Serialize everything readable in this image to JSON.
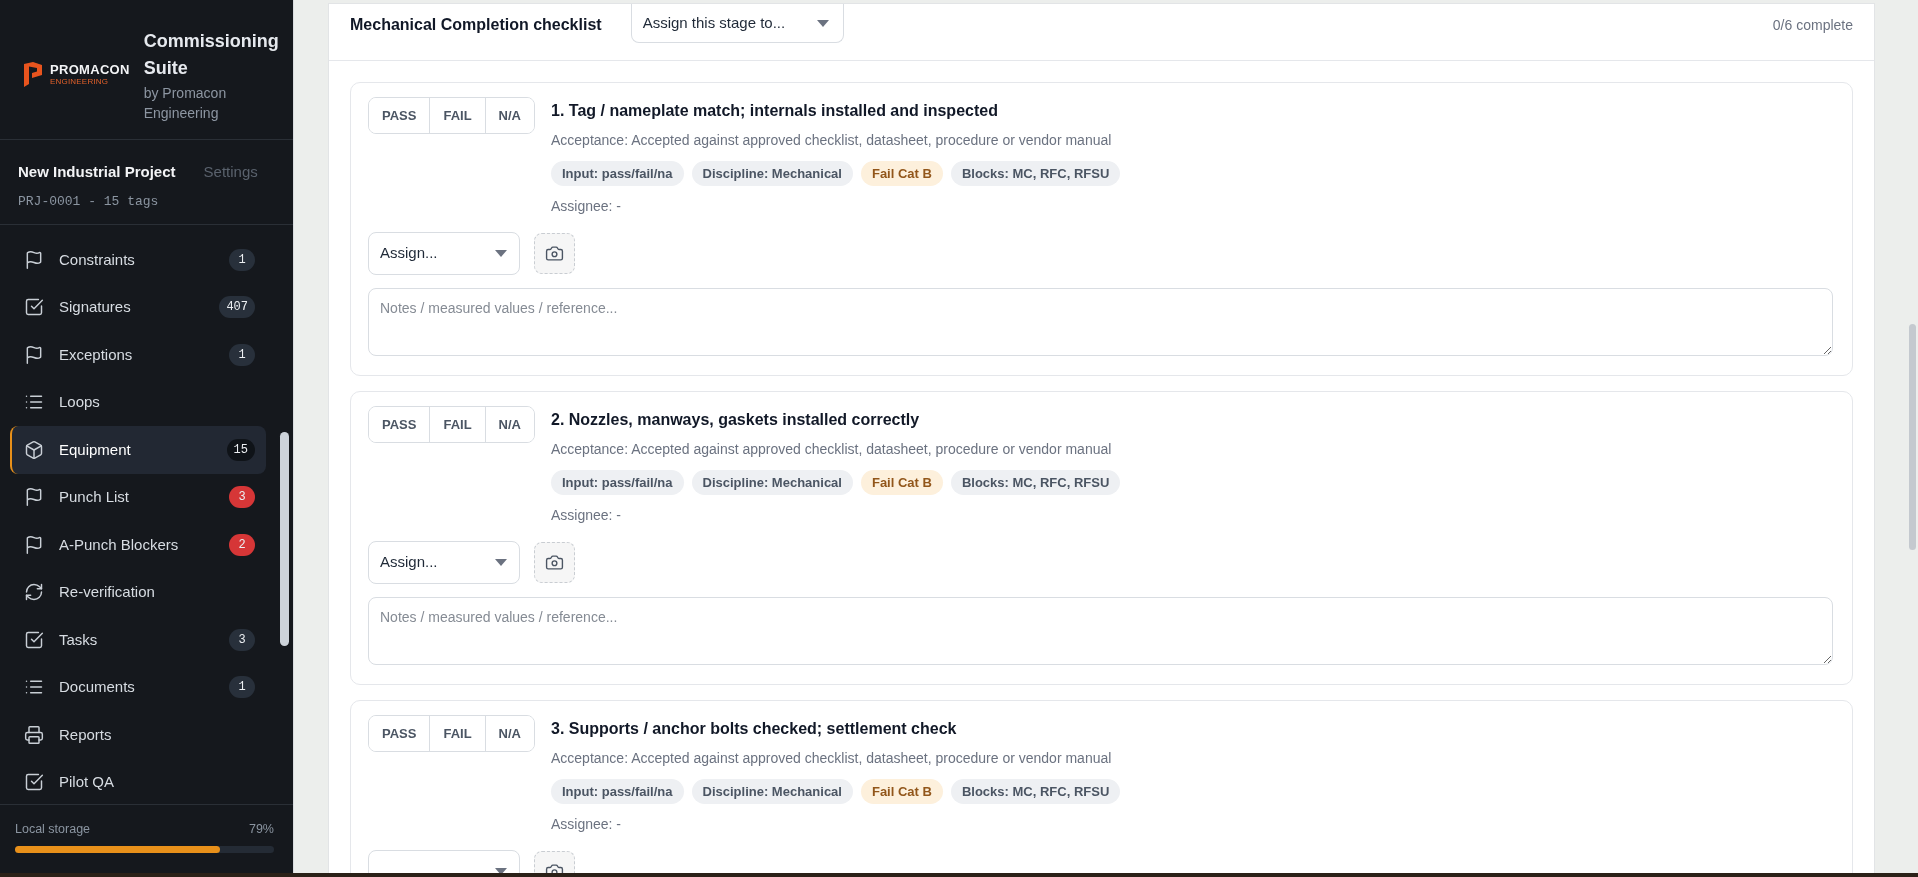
{
  "sidebar": {
    "brand": {
      "logo_name": "PROMACON",
      "logo_tagline": "ENGINEERING",
      "title": "Commissioning Suite",
      "subtitle": "by Promacon Engineering"
    },
    "project": {
      "name": "New Industrial Project",
      "settings_link": "Settings",
      "meta": "PRJ-0001 - 15 tags"
    },
    "nav": [
      {
        "label": "Constraints",
        "kind": "flag",
        "badge": {
          "text": "1",
          "color": "#28303b"
        },
        "selected": false
      },
      {
        "label": "Signatures",
        "kind": "checkbox",
        "badge": {
          "text": "407",
          "color": "#28303b"
        },
        "selected": false
      },
      {
        "label": "Exceptions",
        "kind": "flag",
        "badge": {
          "text": "1",
          "color": "#28303b"
        },
        "selected": false
      },
      {
        "label": "Loops",
        "kind": "list",
        "selected": false
      },
      {
        "label": "Equipment",
        "kind": "cube",
        "badge": {
          "text": "15",
          "color": "#0f1318"
        },
        "selected": true
      },
      {
        "label": "Punch List",
        "kind": "flag",
        "badge": {
          "text": "3",
          "color": "#d63637"
        },
        "selected": false
      },
      {
        "label": "A-Punch Blockers",
        "kind": "flag",
        "badge": {
          "text": "2",
          "color": "#d63637"
        },
        "selected": false
      },
      {
        "label": "Re-verification",
        "kind": "refresh",
        "selected": false
      },
      {
        "label": "Tasks",
        "kind": "checkbox",
        "badge": {
          "text": "3",
          "color": "#28303b"
        },
        "selected": false
      },
      {
        "label": "Documents",
        "kind": "list",
        "badge": {
          "text": "1",
          "color": "#28303b"
        },
        "selected": false
      },
      {
        "label": "Reports",
        "kind": "printer",
        "selected": false
      },
      {
        "label": "Pilot QA",
        "kind": "checkbox",
        "selected": false
      }
    ],
    "storage": {
      "label": "Local storage",
      "reading": "79%",
      "level": 0.79
    }
  },
  "checklist": {
    "title": "Mechanical Completion checklist",
    "stage_assign": {
      "value": "Assign this stage to..."
    },
    "progress": "0/6 complete",
    "items": [
      {
        "title": "1. Tag / nameplate match; internals installed and inspected",
        "acceptance": "Acceptance: Accepted against approved checklist, datasheet, procedure or vendor manual",
        "result_options": [
          {
            "label": "PASS",
            "selected": false
          },
          {
            "label": "FAIL",
            "selected": false
          },
          {
            "label": "N/A",
            "selected": false
          }
        ],
        "tags": [
          {
            "label": "Input: pass/fail/na",
            "kind": "neutral"
          },
          {
            "label": "Discipline: Mechanical",
            "kind": "neutral"
          },
          {
            "label": "Fail Cat B",
            "kind": "warning"
          },
          {
            "label": "Blocks: MC, RFC, RFSU",
            "kind": "neutral"
          }
        ],
        "assignee": "Assignee: -",
        "assign_select": {
          "value": "Assign..."
        },
        "notes": {
          "placeholder": "Notes / measured values / reference..."
        }
      },
      {
        "title": "2. Nozzles, manways, gaskets installed correctly",
        "acceptance": "Acceptance: Accepted against approved checklist, datasheet, procedure or vendor manual",
        "result_options": [
          {
            "label": "PASS",
            "selected": false
          },
          {
            "label": "FAIL",
            "selected": false
          },
          {
            "label": "N/A",
            "selected": false
          }
        ],
        "tags": [
          {
            "label": "Input: pass/fail/na",
            "kind": "neutral"
          },
          {
            "label": "Discipline: Mechanical",
            "kind": "neutral"
          },
          {
            "label": "Fail Cat B",
            "kind": "warning"
          },
          {
            "label": "Blocks: MC, RFC, RFSU",
            "kind": "neutral"
          }
        ],
        "assignee": "Assignee: -",
        "assign_select": {
          "value": "Assign..."
        },
        "notes": {
          "placeholder": "Notes / measured values / reference..."
        }
      },
      {
        "title": "3. Supports / anchor bolts checked; settlement check",
        "acceptance": "Acceptance: Accepted against approved checklist, datasheet, procedure or vendor manual",
        "result_options": [
          {
            "label": "PASS",
            "selected": false
          },
          {
            "label": "FAIL",
            "selected": false
          },
          {
            "label": "N/A",
            "selected": false
          }
        ],
        "tags": [
          {
            "label": "Input: pass/fail/na",
            "kind": "neutral"
          },
          {
            "label": "Discipline: Mechanical",
            "kind": "neutral"
          },
          {
            "label": "Fail Cat B",
            "kind": "warning"
          },
          {
            "label": "Blocks: MC, RFC, RFSU",
            "kind": "neutral"
          }
        ],
        "assignee": "Assignee: -"
      }
    ]
  }
}
